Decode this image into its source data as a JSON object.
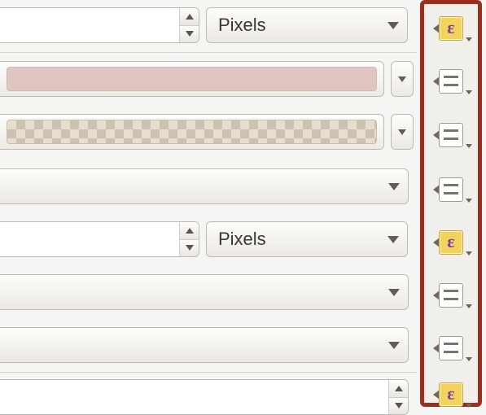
{
  "units": {
    "label_1": "Pixels",
    "label_2": "Pixels"
  },
  "strip": {
    "items": [
      {
        "kind": "epsilon"
      },
      {
        "kind": "list"
      },
      {
        "kind": "list"
      },
      {
        "kind": "list"
      },
      {
        "kind": "epsilon"
      },
      {
        "kind": "list"
      },
      {
        "kind": "list"
      },
      {
        "kind": "epsilon"
      }
    ],
    "epsilon_glyph": "ε"
  }
}
